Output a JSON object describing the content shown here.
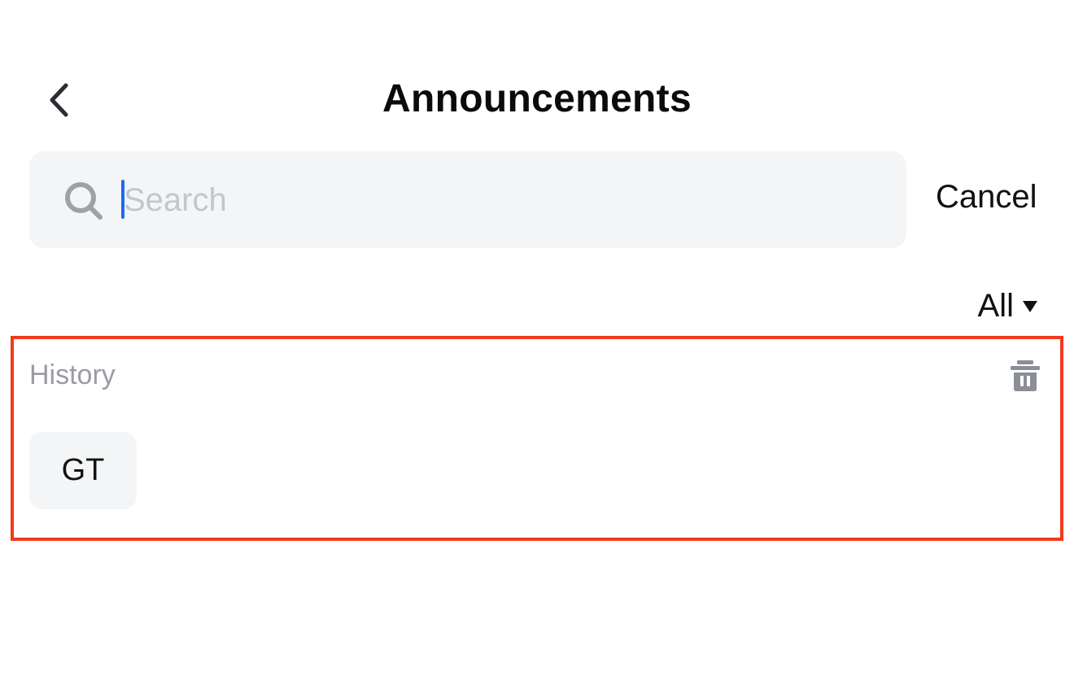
{
  "header": {
    "title": "Announcements",
    "back_icon": "chevron-left-icon"
  },
  "search": {
    "placeholder": "Search",
    "value": "",
    "icon": "search-icon",
    "cancel_label": "Cancel"
  },
  "filter": {
    "label": "All",
    "icon": "caret-down-icon"
  },
  "history": {
    "label": "History",
    "clear_icon": "trash-icon",
    "items": [
      "GT"
    ]
  },
  "colors": {
    "accent_caret": "#1a6cf0",
    "highlight_border": "#f23a1b",
    "field_background": "#f4f5f7",
    "muted_text": "#9a9ca2"
  }
}
